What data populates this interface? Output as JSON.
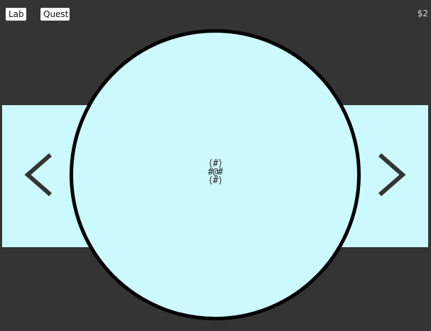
{
  "header": {
    "lab_label": "Lab",
    "quest_label": "Quest",
    "money": "$2"
  },
  "creature": {
    "sprite": "⟨#⟩\n#@#\n⟨#⟩"
  },
  "colors": {
    "background": "#343434",
    "display": "#cbf9fd",
    "circle_border": "#000000",
    "arrow": "#343434"
  },
  "icons": {
    "left": "chevron-left-icon",
    "right": "chevron-right-icon"
  }
}
